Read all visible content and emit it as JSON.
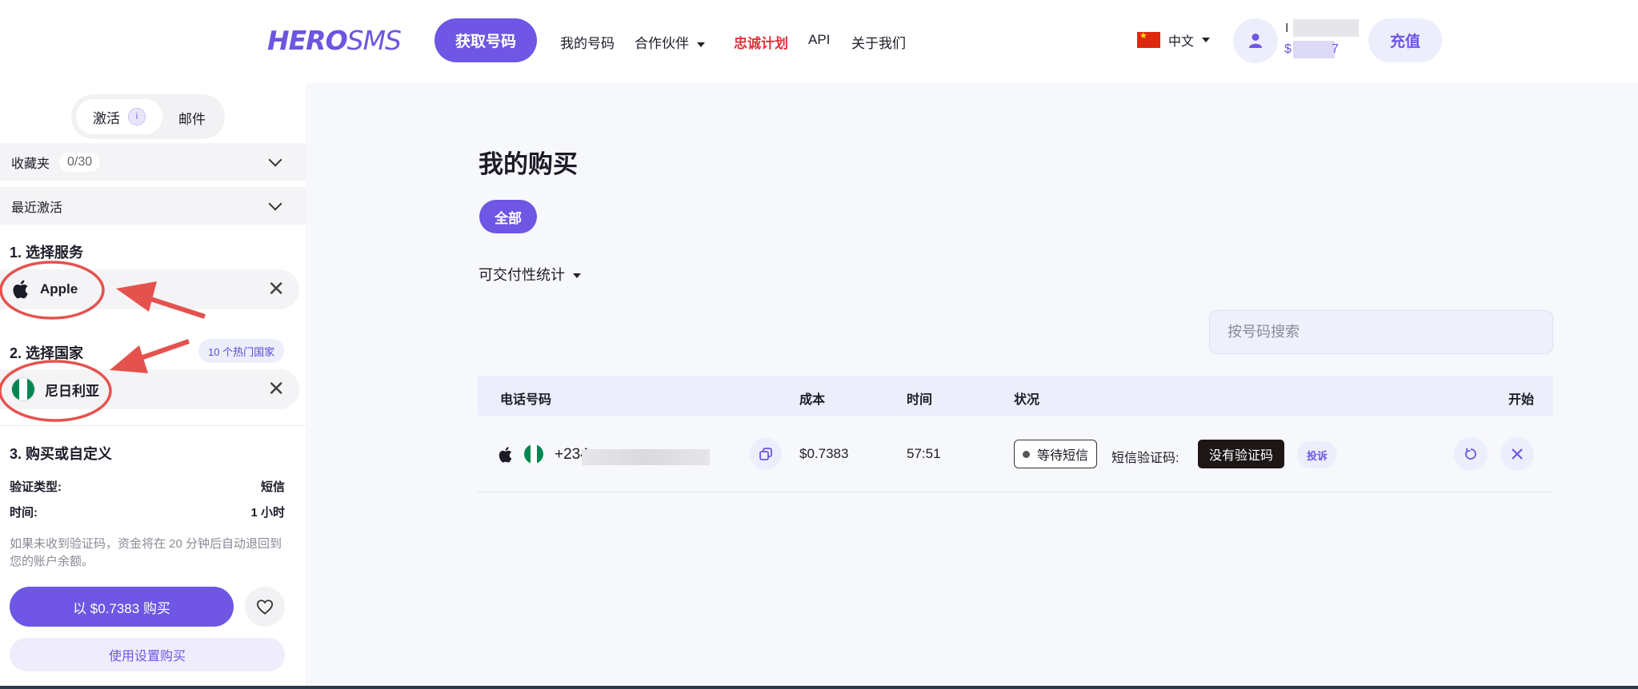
{
  "header": {
    "logo_hero": "HERO",
    "logo_sms": "SMS",
    "get_number": "获取号码",
    "nav": [
      "我的号码",
      "合作伙伴",
      "忠诚计划",
      "API",
      "关于我们"
    ],
    "lang": "中文",
    "user_name": "I",
    "user_balance": "$",
    "user_balance_tail": "7",
    "topup": "充值",
    "colors": {
      "accent": "#6f56e4",
      "loyalty": "#e0323c"
    }
  },
  "sidebar": {
    "tabs": {
      "activate": "激活",
      "mail": "邮件"
    },
    "favorites": {
      "label": "收藏夹",
      "count": "0/30"
    },
    "recent": {
      "label": "最近激活"
    },
    "step1": {
      "title": "1. 选择服务",
      "service": "Apple"
    },
    "step2": {
      "title": "2. 选择国家",
      "hot": "10 个热门国家",
      "country": "尼日利亚"
    },
    "step3": {
      "title": "3. 购买或自定义",
      "verify_type_label": "验证类型:",
      "verify_type_value": "短信",
      "time_label": "时间:",
      "time_value": "1 小时",
      "note": "如果未收到验证码，资金将在 20 分钟后自动退回到您的账户余额。",
      "buy": "以 $0.7383 购买",
      "buy_with_settings": "使用设置购买"
    }
  },
  "main": {
    "title": "我的购买",
    "filter_all": "全部",
    "stats": "可交付性统计",
    "search_placeholder": "按号码搜索",
    "table": {
      "headers": {
        "phone": "电话号码",
        "cost": "成本",
        "time": "时间",
        "status": "状况",
        "start": "开始"
      },
      "rows": [
        {
          "phone": "+234",
          "cost": "$0.7383",
          "time": "57:51",
          "status": "等待短信",
          "sms_label": "短信验证码:",
          "no_code": "没有验证码",
          "complain": "投诉"
        }
      ]
    }
  }
}
